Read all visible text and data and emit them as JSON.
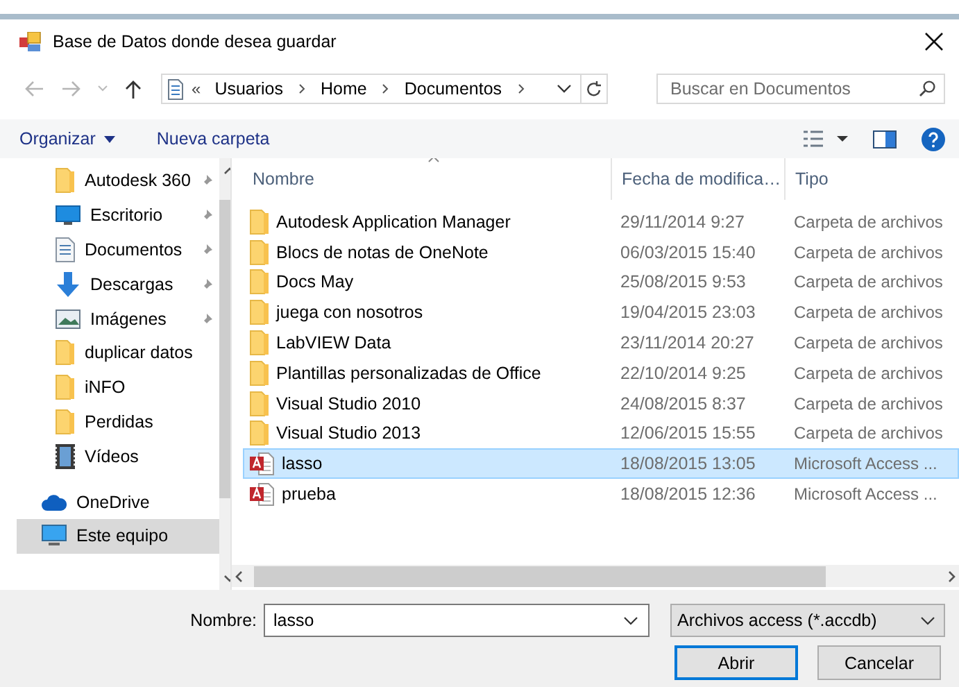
{
  "window": {
    "title": "Base de Datos donde desea guardar"
  },
  "navigation": {
    "overflow_marker": "«",
    "breadcrumb": [
      {
        "label": "Usuarios"
      },
      {
        "label": "Home"
      },
      {
        "label": "Documentos"
      }
    ],
    "search": {
      "placeholder": "Buscar en Documentos"
    }
  },
  "toolbar": {
    "buttons": [
      {
        "label": "Organizar",
        "dropdown": true
      },
      {
        "label": "Nueva carpeta",
        "dropdown": false
      }
    ]
  },
  "sidebar": {
    "quick_access": [
      {
        "label": "Autodesk 360",
        "kind": "folder",
        "pinned": true,
        "selected": false
      },
      {
        "label": "Escritorio",
        "kind": "desktop",
        "pinned": true,
        "selected": false
      },
      {
        "label": "Documentos",
        "kind": "document",
        "pinned": true,
        "selected": false
      },
      {
        "label": "Descargas",
        "kind": "download",
        "pinned": true,
        "selected": false
      },
      {
        "label": "Imágenes",
        "kind": "pictures",
        "pinned": true,
        "selected": false
      },
      {
        "label": "duplicar datos",
        "kind": "folder",
        "pinned": false,
        "selected": false
      },
      {
        "label": "iNFO",
        "kind": "folder",
        "pinned": false,
        "selected": false
      },
      {
        "label": "Perdidas",
        "kind": "folder",
        "pinned": false,
        "selected": false
      },
      {
        "label": "Vídeos",
        "kind": "video",
        "pinned": false,
        "selected": false
      }
    ],
    "locations": [
      {
        "label": "OneDrive",
        "kind": "cloud",
        "selected": false
      },
      {
        "label": "Este equipo",
        "kind": "computer",
        "selected": true
      }
    ]
  },
  "file_list": {
    "columns": [
      {
        "label": "Nombre",
        "sorted": true
      },
      {
        "label": "Fecha de modifica…",
        "sorted": false
      },
      {
        "label": "Tipo",
        "sorted": false
      }
    ],
    "rows": [
      {
        "kind": "folder",
        "name": "Autodesk Application Manager",
        "date": "29/11/2014 9:27",
        "type": "Carpeta de archivos",
        "selected": false
      },
      {
        "kind": "folder",
        "name": "Blocs de notas de OneNote",
        "date": "06/03/2015 15:40",
        "type": "Carpeta de archivos",
        "selected": false
      },
      {
        "kind": "folder",
        "name": "Docs May",
        "date": "25/08/2015 9:53",
        "type": "Carpeta de archivos",
        "selected": false
      },
      {
        "kind": "folder",
        "name": "juega con nosotros",
        "date": "19/04/2015 23:03",
        "type": "Carpeta de archivos",
        "selected": false
      },
      {
        "kind": "folder",
        "name": "LabVIEW Data",
        "date": "23/11/2014 20:27",
        "type": "Carpeta de archivos",
        "selected": false
      },
      {
        "kind": "folder",
        "name": "Plantillas personalizadas de Office",
        "date": "22/10/2014 9:25",
        "type": "Carpeta de archivos",
        "selected": false
      },
      {
        "kind": "folder",
        "name": "Visual Studio 2010",
        "date": "24/08/2015 8:37",
        "type": "Carpeta de archivos",
        "selected": false
      },
      {
        "kind": "folder",
        "name": "Visual Studio 2013",
        "date": "12/06/2015 15:55",
        "type": "Carpeta de archivos",
        "selected": false
      },
      {
        "kind": "access",
        "name": "lasso",
        "date": "18/08/2015 13:05",
        "type": "Microsoft Access ...",
        "selected": true
      },
      {
        "kind": "access",
        "name": "prueba",
        "date": "18/08/2015 12:36",
        "type": "Microsoft Access ...",
        "selected": false
      }
    ]
  },
  "footer": {
    "filename": {
      "label": "Nombre:",
      "value": "lasso"
    },
    "filetype": {
      "value": "Archivos access (*.accdb)"
    },
    "buttons": [
      {
        "label": "Abrir",
        "default": true
      },
      {
        "label": "Cancelar",
        "default": false
      }
    ]
  }
}
